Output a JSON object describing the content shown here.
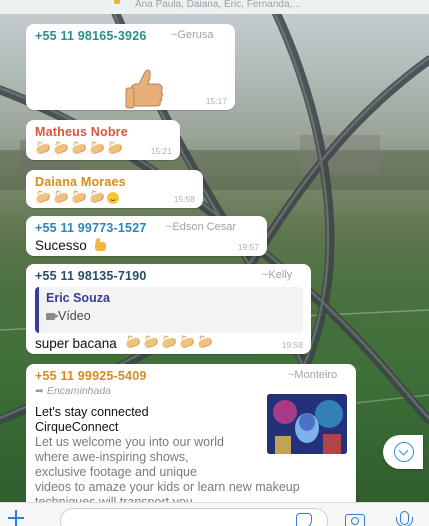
{
  "header": {
    "members": "Ana Paula, Daiana, Eric, Fernanda,..."
  },
  "messages": [
    {
      "sender": "+55 11 98165-3926",
      "alias": "~Gerusa",
      "sender_color": "#2a8f86",
      "content_icon": "thumbs-up-sticker",
      "time": "15:17"
    },
    {
      "sender": "Matheus Nobre",
      "sender_color": "#d6563f",
      "content_icon": "clapping-hands-emoji",
      "time": "15:21"
    },
    {
      "sender": "Daiana Moraes",
      "sender_color": "#d98a1f",
      "content_icon": "clapping-hands-emoji",
      "time": "15:58"
    },
    {
      "sender": "+55 11 99773-1527",
      "alias": "~Edson Cesar",
      "sender_color": "#2b86b8",
      "text": "Sucesso",
      "time": "19:57"
    },
    {
      "sender": "+55 11 98135-7190",
      "alias": "~Kelly",
      "sender_color": "#2a4d66",
      "quote": {
        "name": "Eric Souza",
        "type": "Vídeo"
      },
      "text": "super bacana",
      "time": "19:58"
    },
    {
      "sender": "+55 11 99925-5409",
      "alias": "~Monteiro",
      "sender_color": "#d98a1f",
      "forwarded": "Encaminhada",
      "ad_title_1": "Let's stay connected",
      "ad_title_2": "CirqueConnect",
      "ad_body": [
        "Let us welcome you into our world",
        "where awe-inspiring shows,",
        "exclusive footage and unique",
        "videos to amaze your kids or learn new makeup",
        "techniques will transport you."
      ]
    }
  ],
  "input_bar": {
    "placeholder": ""
  },
  "colors": {
    "accent": "#2f7fd6",
    "bubble": "#ffffff"
  }
}
